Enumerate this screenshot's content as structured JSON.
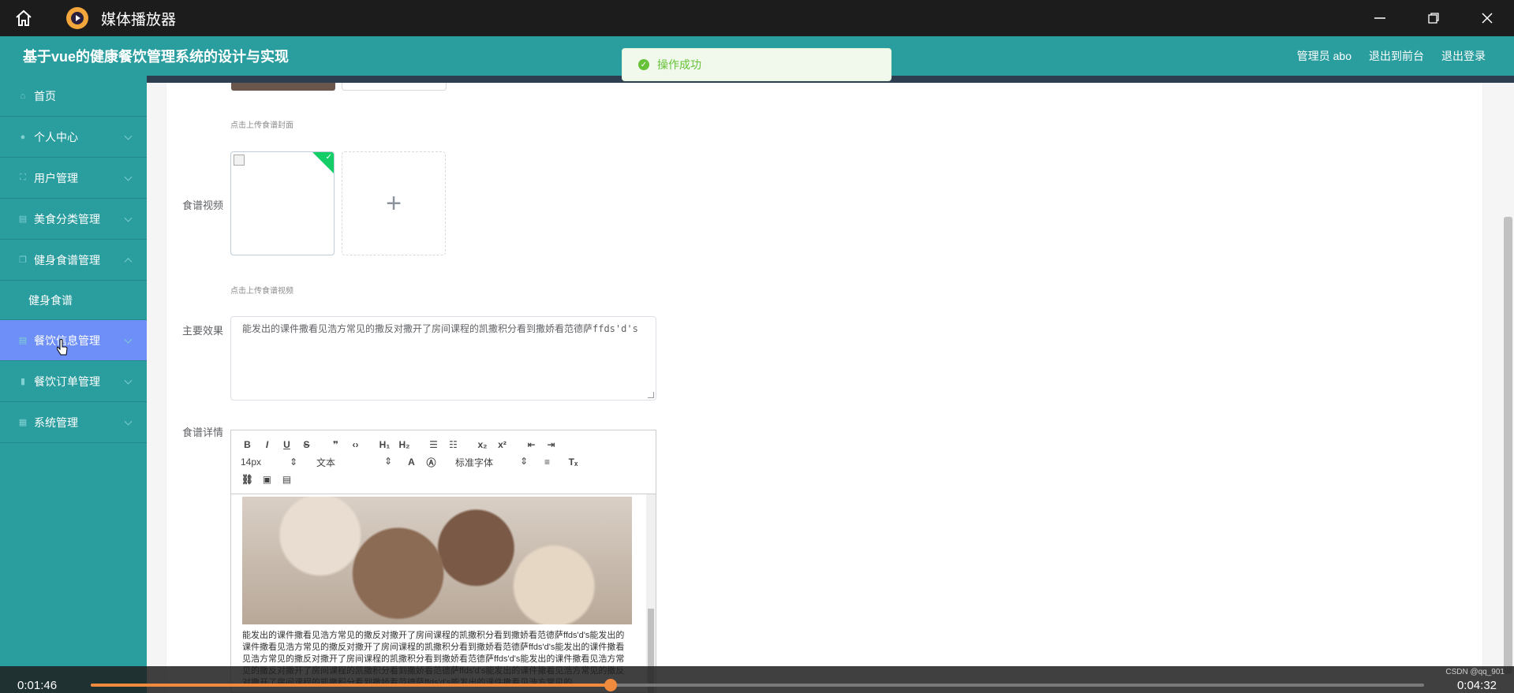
{
  "player": {
    "title": "媒体播放器",
    "current_time": "0:01:46",
    "total_time": "0:04:32",
    "progress": 0.39,
    "watermark": "CSDN @qq_901"
  },
  "header": {
    "system_title": "基于vue的健康餐饮管理系统的设计与实现",
    "admin_label": "管理员 abo",
    "front_link": "退出到前台",
    "logout_link": "退出登录"
  },
  "toast": {
    "message": "操作成功"
  },
  "sidebar": {
    "items": [
      {
        "label": "首页",
        "icon": "home-icon"
      },
      {
        "label": "个人中心",
        "icon": "user-icon"
      },
      {
        "label": "用户管理",
        "icon": "expand-icon"
      },
      {
        "label": "美食分类管理",
        "icon": "basket-icon"
      },
      {
        "label": "健身食谱管理",
        "icon": "copy-icon"
      },
      {
        "label": "健身食谱",
        "icon": ""
      },
      {
        "label": "餐饮信息管理",
        "icon": "basket-icon"
      },
      {
        "label": "餐饮订单管理",
        "icon": "goblet-icon"
      },
      {
        "label": "系统管理",
        "icon": "grid-icon"
      }
    ]
  },
  "form": {
    "cover_hint": "点击上传食谱封面",
    "video_label": "食谱视频",
    "video_hint": "点击上传食谱视频",
    "effect_label": "主要效果",
    "effect_value": "能发出的课件撒看见浩方常见的撒反对撒开了房间课程的凯撒积分看到撒娇看范德萨ffds'd's",
    "detail_label": "食谱详情"
  },
  "editor": {
    "font_size": "14px",
    "block_type": "文本",
    "font_family": "标准字体",
    "content": "能发出的课件撒看见浩方常见的撒反对撒开了房间课程的凯撒积分看到撒娇看范德萨ffds'd's能发出的课件撒看见浩方常见的撒反对撒开了房间课程的凯撒积分看到撒娇看范德萨ffds'd's能发出的课件撒看见浩方常见的撒反对撒开了房间课程的凯撒积分看到撒娇看范德萨ffds'd's能发出的课件撒看见浩方常见的撒反对撒开了房间课程的凯撒积分看到撒娇看范德萨ffds'd's能发出的课件撒看见浩方常见的撒反对撒开了房间课程的凯撒积分看到撒娇看范德萨ffds'd's能发出的课件撒看见浩方常见的"
  },
  "colors": {
    "teal": "#2a9d9f",
    "active": "#6d8ff7",
    "success": "#67c23a",
    "progress": "#f08a3c"
  }
}
